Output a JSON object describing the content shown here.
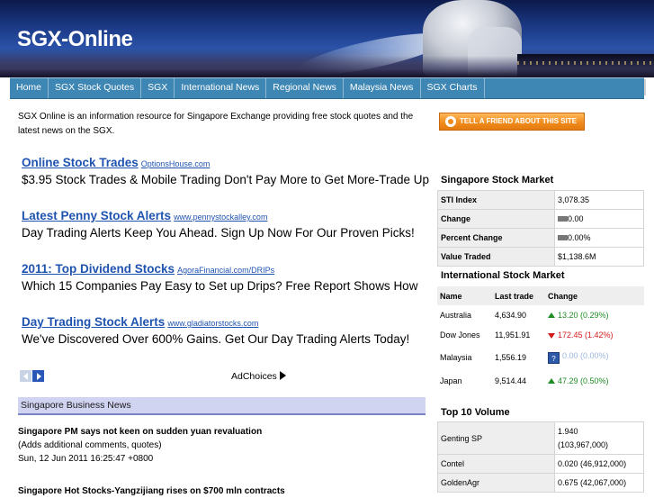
{
  "site": {
    "title": "SGX-Online"
  },
  "nav": [
    "Home",
    "SGX Stock Quotes",
    "SGX",
    "International News",
    "Regional News",
    "Malaysia News",
    "SGX Charts"
  ],
  "intro": "SGX Online is an information resource for Singapore Exchange providing free stock quotes and the latest news on the SGX.",
  "tell_friend": "TELL A FRIEND ABOUT THIS SITE",
  "ads": [
    {
      "title": "Online Stock Trades",
      "url": "OptionsHouse.com",
      "text": "$3.95 Stock Trades & Mobile Trading Don't Pay More to Get More-Trade Up"
    },
    {
      "title": "Latest Penny Stock Alerts",
      "url": "www.pennystockalley.com",
      "text": "Day Trading Alerts Keep You Ahead. Sign Up Now For Our Proven Picks!"
    },
    {
      "title": "2011: Top Dividend Stocks",
      "url": "AgoraFinancial.com/DRIPs",
      "text": "Which 15 Companies Pay Easy to Set up Drips? Free Report Shows How"
    },
    {
      "title": "Day Trading Stock Alerts",
      "url": "www.gladiatorstocks.com",
      "text": "We've Discovered Over 600% Gains. Get Our Day Trading Alerts Today!"
    }
  ],
  "adchoices": "AdChoices",
  "business_news": {
    "header": "Singapore Business News",
    "items": [
      {
        "title": "Singapore PM says not keen on sudden yuan revaluation",
        "subtitle": "(Adds additional comments, quotes)",
        "date": "Sun, 12 Jun 2011 16:25:47 +0800"
      },
      {
        "title": "Singapore Hot Stocks-Yangzijiang rises on $700 mln contracts"
      }
    ]
  },
  "sgx_market": {
    "title": "Singapore Stock Market",
    "rows": [
      {
        "label": "STI Index",
        "value": "3,078.35"
      },
      {
        "label": "Change",
        "value": "0.00"
      },
      {
        "label": "Percent Change",
        "value": "0.00%"
      },
      {
        "label": "Value Traded",
        "value": "$1,138.6M"
      }
    ]
  },
  "intl_market": {
    "title": "International Stock Market",
    "headers": [
      "Name",
      "Last trade",
      "Change"
    ],
    "rows": [
      {
        "name": "Australia",
        "last": "4,634.90",
        "change": "13.20 (0.29%)",
        "dir": "up"
      },
      {
        "name": "Dow Jones",
        "last": "11,951.91",
        "change": "172.45 (1.42%)",
        "dir": "down"
      },
      {
        "name": "Malaysia",
        "last": "1,556.19",
        "change": "0.00 (0.00%)",
        "dir": "none"
      },
      {
        "name": "Japan",
        "last": "9,514.44",
        "change": "47.29 (0.50%)",
        "dir": "up"
      }
    ]
  },
  "top10": {
    "title": "Top 10 Volume",
    "rows": [
      {
        "name": "Genting SP",
        "v1": "1.940",
        "v2": "(103,967,000)"
      },
      {
        "name": "Contel",
        "v1": "0.020 (46,912,000)"
      },
      {
        "name": "GoldenAgr",
        "v1": "0.675 (42,067,000)"
      }
    ]
  },
  "colors": {
    "nav_bg": "#3e86b3",
    "link": "#1f53b0",
    "up": "#1f8c25",
    "down": "#d21a1a",
    "button": "#f08a1a",
    "news_bar": "#d0d4f0"
  },
  "icons": [
    "up-arrow-icon",
    "down-arrow-icon",
    "help-icon",
    "prev-icon",
    "next-icon",
    "adchoices-icon"
  ]
}
